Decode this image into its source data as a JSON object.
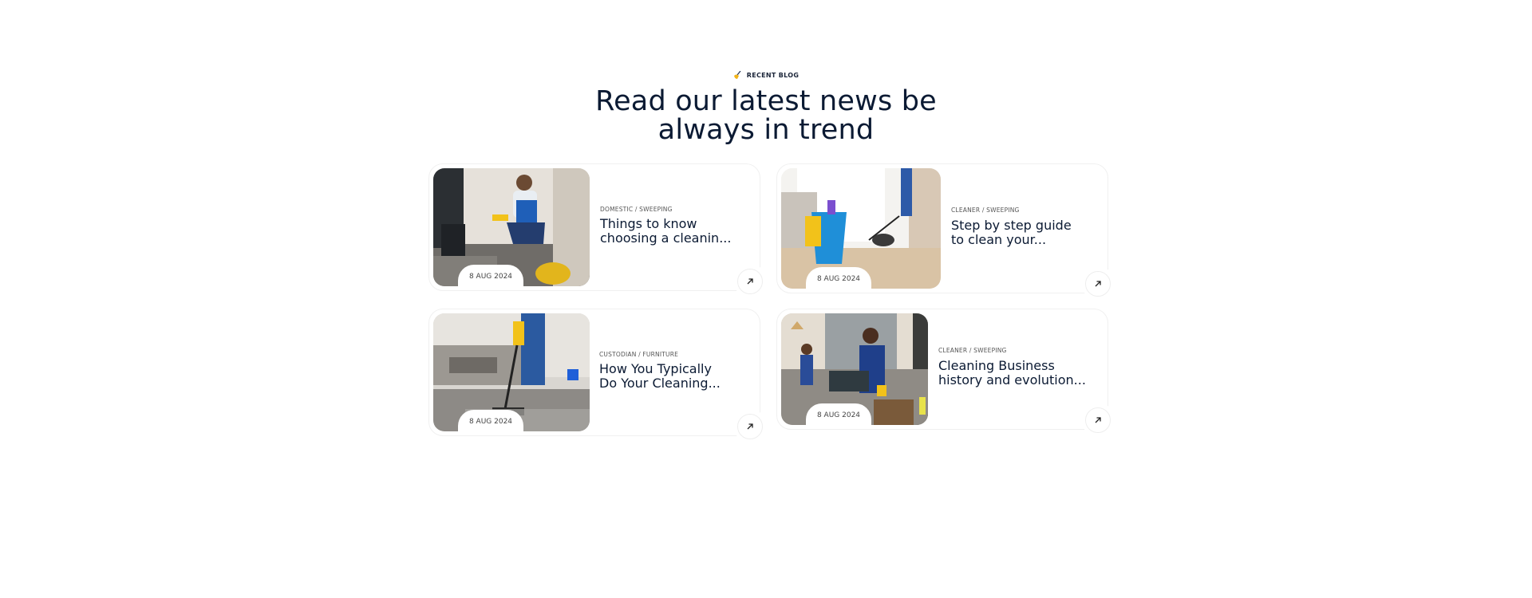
{
  "section": {
    "eyebrow": "RECENT BLOG",
    "title_line1": "Read our latest news be",
    "title_line2": "always in trend"
  },
  "posts": [
    {
      "category": "DOMESTIC / SWEEPING",
      "title_line1": "Things to know",
      "title_line2": "choosing a cleanin...",
      "date": "8 AUG 2024",
      "image": "man-cleaning-floor-photo"
    },
    {
      "category": "CLEANER / SWEEPING",
      "title_line1": "Step by step guide",
      "title_line2": "to clean your...",
      "date": "8 AUG 2024",
      "image": "vacuum-and-bucket-photo"
    },
    {
      "category": "CUSTODIAN / FURNITURE",
      "title_line1": "How You Typically",
      "title_line2": "Do Your Cleaning...",
      "date": "8 AUG 2024",
      "image": "vacuuming-rug-photo"
    },
    {
      "category": "CLEANER / SWEEPING",
      "title_line1": "Cleaning Business",
      "title_line2": "history and evolution...",
      "date": "8 AUG 2024",
      "image": "team-cleaning-office-photo"
    }
  ],
  "colors": {
    "heading": "#0b1a33",
    "accent_yellow": "#f2b418",
    "border": "#f0f0f0"
  }
}
